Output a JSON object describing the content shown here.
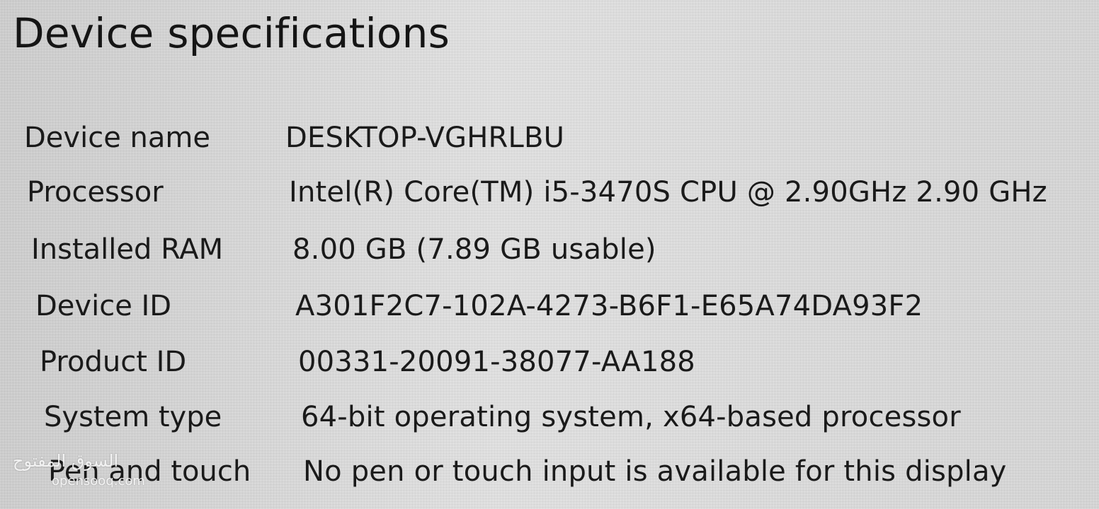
{
  "section": {
    "title": "Device specifications"
  },
  "specs": [
    {
      "label": "Device name",
      "value": "DESKTOP-VGHRLBU"
    },
    {
      "label": "Processor",
      "value": "Intel(R) Core(TM) i5-3470S CPU @ 2.90GHz   2.90 GHz"
    },
    {
      "label": "Installed RAM",
      "value": "8.00 GB (7.89 GB usable)"
    },
    {
      "label": "Device ID",
      "value": "A301F2C7-102A-4273-B6F1-E65A74DA93F2"
    },
    {
      "label": "Product ID",
      "value": "00331-20091-38077-AA188"
    },
    {
      "label": "System type",
      "value": "64-bit operating system, x64-based processor"
    },
    {
      "label": "Pen and touch",
      "value": "No pen or touch input is available for this display"
    }
  ],
  "watermark": {
    "arabic": "السوق المفتوح",
    "latin": "opensooq.com"
  }
}
